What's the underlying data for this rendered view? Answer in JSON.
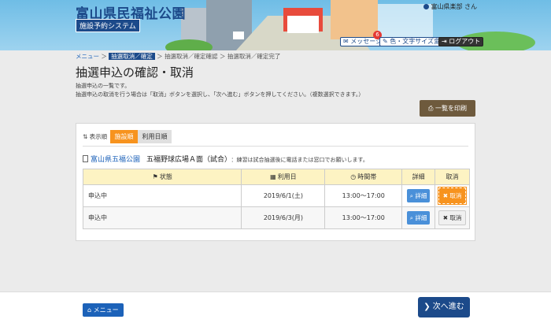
{
  "header": {
    "site_title": "富山県民福祉公園",
    "system_name": "施設予約システム",
    "user_name": "富山県楽部 さん",
    "message_label": "メッセージ",
    "message_count": "6",
    "color_label": "色・文字サイズ変更",
    "logout_label": "ログアウト"
  },
  "breadcrumb": {
    "menu": "メニュー",
    "sep": "＞",
    "current": "抽選取消／確定",
    "rest": "抽選取消／確定確認 ＞ 抽選取消／確定完了"
  },
  "page": {
    "title": "抽選申込の確認・取消",
    "desc1": "抽選申込の一覧です。",
    "desc2": "抽選申込の取消を行う場合は「取消」ボタンを選択し、「次へ進む」ボタンを押してください。（複数選択できます。）",
    "print_label": "一覧を印刷"
  },
  "sort": {
    "label": "表示順",
    "tab1": "施設順",
    "tab2": "利用日順"
  },
  "facility": {
    "name": "富山県五福公園",
    "court": "五福野球広場Ａ面（試合）",
    "note": "：練習は試合抽選後に電話または窓口でお願いします。"
  },
  "table": {
    "headers": [
      "状態",
      "利用日",
      "時間帯",
      "詳細",
      "取消"
    ],
    "rows": [
      {
        "status": "申込中",
        "date": "2019/6/1(土)",
        "time": "13:00～17:00",
        "detail": "詳細",
        "cancel": "取消"
      },
      {
        "status": "申込中",
        "date": "2019/6/3(月)",
        "time": "13:00～17:00",
        "detail": "詳細",
        "cancel": "取消"
      }
    ]
  },
  "footer": {
    "menu_label": "メニュー",
    "next_label": "次へ進む"
  },
  "colors": {
    "accent": "#1c4a8a",
    "orange": "#f7931e",
    "brown": "#6e5a3d"
  }
}
